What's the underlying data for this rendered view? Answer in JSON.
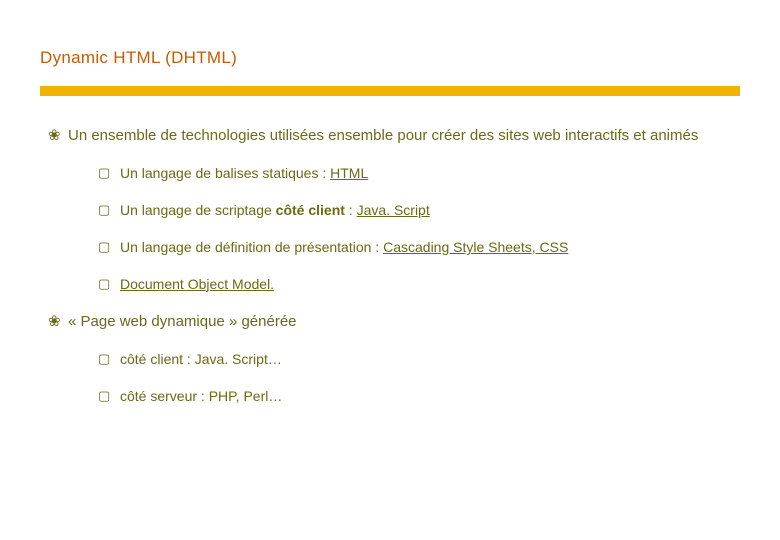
{
  "title": "Dynamic HTML (DHTML)",
  "main": {
    "items": [
      {
        "text": "Un ensemble de technologies utilisées ensemble pour créer des sites web interactifs et animés",
        "sub": [
          {
            "pre": "Un langage de balises statiques : ",
            "link": "HTML"
          },
          {
            "pre": "Un langage de scriptage ",
            "bold": "côté client",
            "mid": " : ",
            "link": "Java. Script"
          },
          {
            "pre": "Un langage de définition de présentation : ",
            "link": "Cascading Style Sheets, CSS"
          },
          {
            "pre": " ",
            "link": "Document Object Model."
          }
        ]
      },
      {
        "text": " « Page web dynamique » générée",
        "sub": [
          {
            "pre": "côté client : Java. Script…"
          },
          {
            "pre": "côté serveur : PHP, Perl…"
          }
        ]
      }
    ]
  },
  "bullets": {
    "l1": "❀",
    "l2": "▢"
  }
}
